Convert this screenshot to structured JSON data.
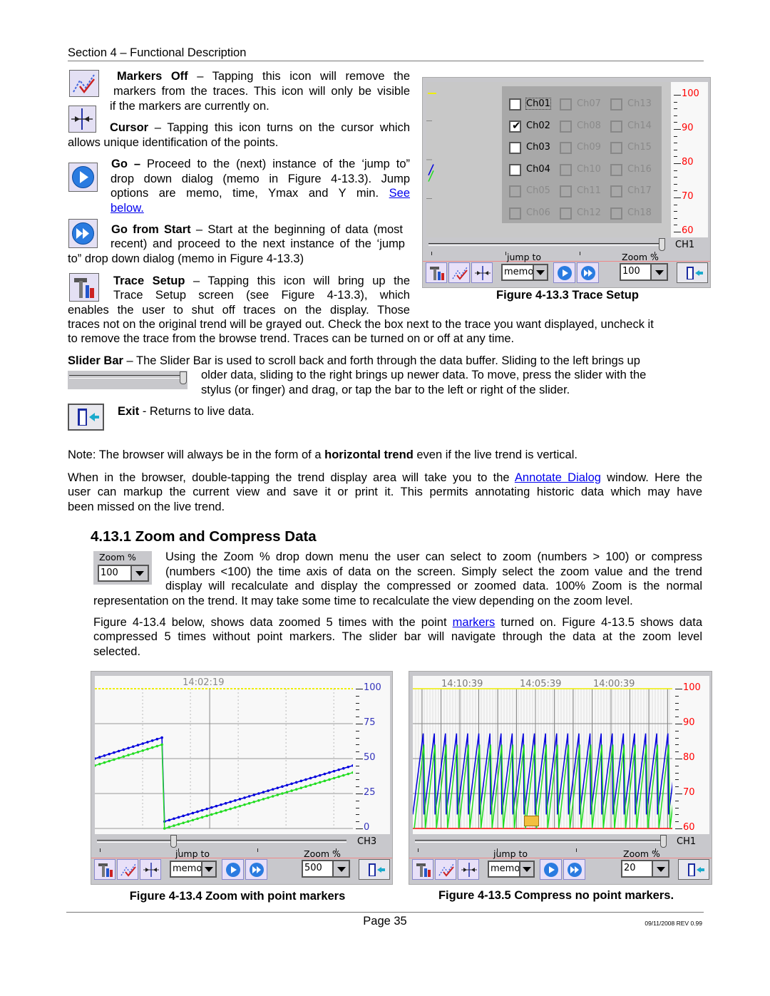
{
  "header": {
    "section": "Section 4 – Functional Description"
  },
  "markers_off": {
    "title": "Markers Off",
    "l1": "– Tapping this icon will remove the",
    "l2": "markers from the traces. This icon will only be visible",
    "l3": "if the markers are currently on."
  },
  "cursor": {
    "title": "Cursor",
    "l1": "– Tapping this icon turns on the cursor which",
    "l2": "allows unique identification of the points."
  },
  "go": {
    "title": "Go –",
    "l1": "Proceed to the (next)  instance of the ‘jump to”",
    "l2": "drop down dialog (memo in Figure 4-13.3). Jump",
    "l3": "options are memo, time, Ymax and Y min.",
    "link1": "See",
    "link2": "below."
  },
  "go_from_start": {
    "title": "Go from Start",
    "l1": "– Start at the beginning of data (most",
    "l2": "recent) and proceed to the next instance of the ‘jump",
    "l3": "to” drop down dialog (memo in Figure 4-13.3)"
  },
  "trace_setup": {
    "title": "Trace Setup",
    "l1": "– Tapping this icon will bring up the",
    "l2": "Trace Setup screen (see Figure 4-13.3), which",
    "l3": "enables the user to shut off traces on the display. Those",
    "l4": "traces not on the original trend will be grayed out. Check the box next to the trace you want displayed, uncheck it",
    "l5": "to remove the trace from the browse trend. Traces can be turned on or off at any time."
  },
  "slider_bar": {
    "title": "Slider Bar",
    "l1": "– The Slider Bar is used to scroll back and forth through the data buffer. Sliding to the left brings up",
    "l2": "older data, sliding to the right brings up newer data. To move, press the slider with the",
    "l3": "stylus (or finger) and drag, or tap the bar to the left or right of the slider."
  },
  "exit": {
    "title": "Exit",
    "text": " - Returns to live data."
  },
  "note": {
    "pre": "Note: The browser will always be in the form of a ",
    "bold": "horizontal trend",
    "post": " even if the live trend is vertical."
  },
  "browser": {
    "l1_pre": "When in the browser, double-tapping the trend display area will take you to the ",
    "l1_link": "Annotate Dialog",
    "l1_post": " window. Here the",
    "l2": "user can markup the current view and save it or print it. This permits annotating historic data which may have",
    "l3": "been missed on the live trend."
  },
  "section_heading": "4.13.1 Zoom and Compress Data",
  "zoom_widget": {
    "label": "Zoom %",
    "value": "100"
  },
  "zoom_para": {
    "l1": "Using the Zoom % drop down menu the user can select to zoom (numbers > 100) or compress",
    "l2": "(numbers <100) the time axis of data on the screen. Simply select the zoom value and the trend",
    "l3": "display will recalculate and display the compressed or zoomed data. 100% Zoom is the normal",
    "l4": "representation on the trend. It may take some time to recalculate the view depending on the zoom level."
  },
  "figure_para": {
    "l1_pre": "Figure 4-13.4 below, shows data zoomed 5 times with the point ",
    "l1_link": "markers",
    "l1_post": " turned on. Figure 4-13.5 shows data",
    "l2": "compressed 5 times without point markers. The slider bar will navigate through the data at the zoom level",
    "l3": "selected."
  },
  "figures": [
    {
      "caption": "Figure 4-13.3  Trace Setup",
      "channel_label": "CH1",
      "jump_label": "jump to",
      "jump_value": "memo",
      "zoom_label": "Zoom %",
      "zoom_value": "100",
      "scale_color": "#ff0000",
      "ticks": [
        "100",
        "90",
        "80",
        "70",
        "60"
      ],
      "channels": [
        {
          "name": "Ch01",
          "state": "unchecked"
        },
        {
          "name": "Ch02",
          "state": "checked"
        },
        {
          "name": "Ch03",
          "state": "unchecked"
        },
        {
          "name": "Ch04",
          "state": "unchecked"
        },
        {
          "name": "Ch05",
          "state": "grayed"
        },
        {
          "name": "Ch06",
          "state": "grayed"
        },
        {
          "name": "Ch07",
          "state": "grayed"
        },
        {
          "name": "Ch08",
          "state": "grayed"
        },
        {
          "name": "Ch09",
          "state": "grayed"
        },
        {
          "name": "Ch10",
          "state": "grayed"
        },
        {
          "name": "Ch11",
          "state": "grayed"
        },
        {
          "name": "Ch12",
          "state": "grayed"
        },
        {
          "name": "Ch13",
          "state": "grayed"
        },
        {
          "name": "Ch14",
          "state": "grayed"
        },
        {
          "name": "Ch15",
          "state": "grayed"
        },
        {
          "name": "Ch16",
          "state": "grayed"
        },
        {
          "name": "Ch17",
          "state": "grayed"
        },
        {
          "name": "Ch18",
          "state": "grayed"
        }
      ],
      "slider_position": 1.0
    },
    {
      "caption": "Figure 4-13.4  Zoom with point markers",
      "channel_label": "CH3",
      "jump_label": "jump to",
      "jump_value": "memo",
      "zoom_label": "Zoom %",
      "zoom_value": "500",
      "scale_color": "#3333bb",
      "ticks": [
        "100",
        "75",
        "50",
        "25",
        "0"
      ],
      "times": [
        "14:02:19"
      ],
      "slider_position": 0.3,
      "markers": true
    },
    {
      "caption": "Figure 4-13.5  Compress no point markers.",
      "channel_label": "CH1",
      "jump_label": "jump to",
      "jump_value": "memo",
      "zoom_label": "Zoom %",
      "zoom_value": "20",
      "scale_color": "#ff0000",
      "ticks": [
        "100",
        "90",
        "80",
        "70",
        "60"
      ],
      "times": [
        "14:10:39",
        "14:05:39",
        "14:00:39"
      ],
      "slider_position": 1.0,
      "markers": false
    }
  ],
  "colors": {
    "trace_blue": "#0000dd",
    "trace_green": "#22dd22",
    "limit_yellow": "#eeee00",
    "link": "#0000ee"
  },
  "footer": {
    "page": "Page 35",
    "revision": "09/11/2008 REV 0.99"
  }
}
